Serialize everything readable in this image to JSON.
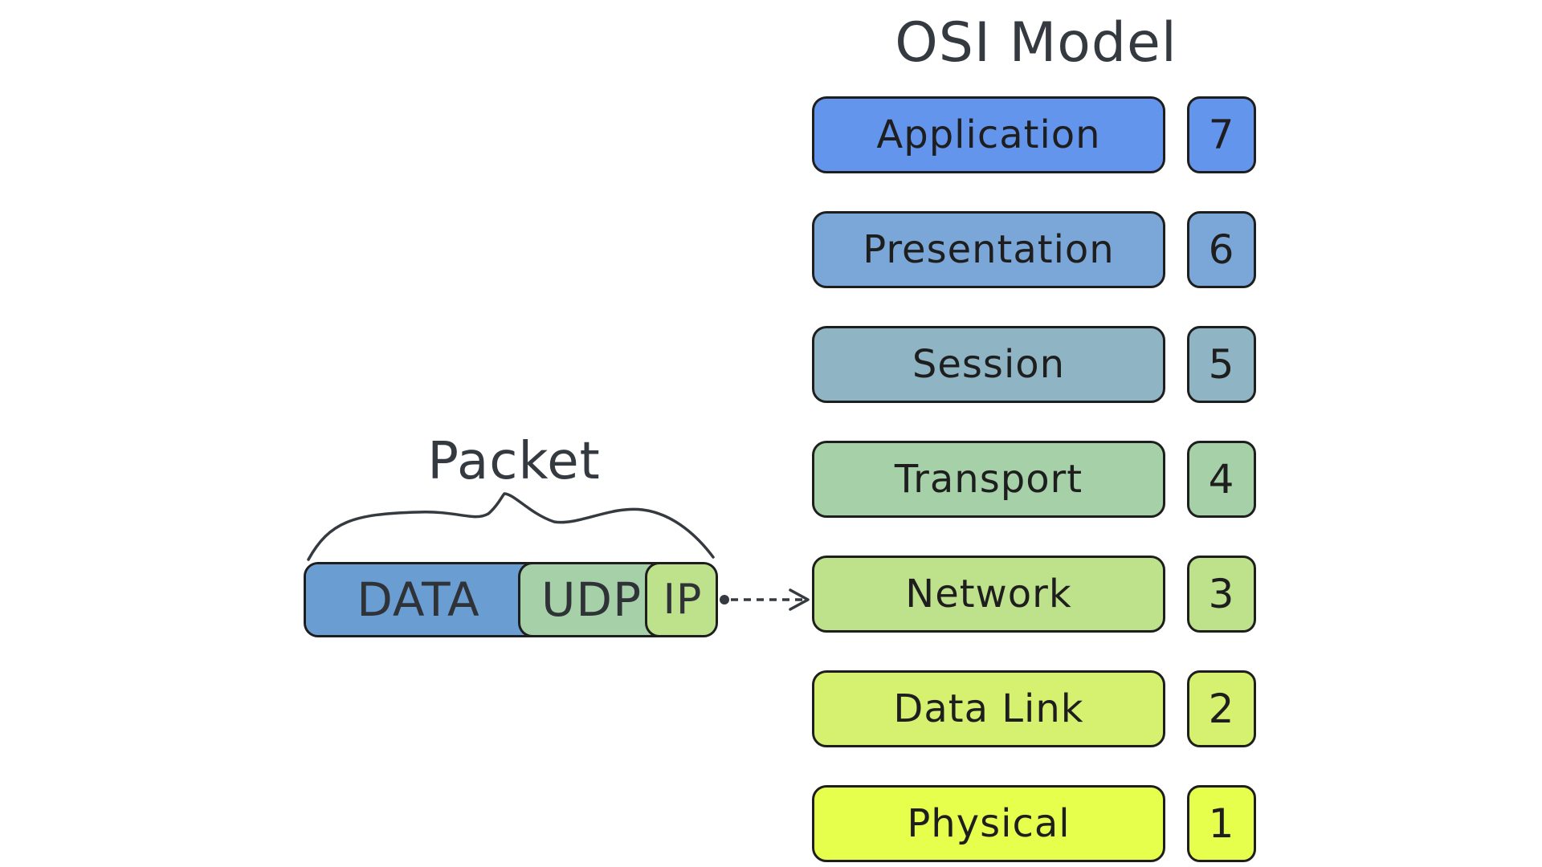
{
  "title": "OSI Model",
  "layers": [
    {
      "name": "Application",
      "number": "7",
      "color": "#6495ED"
    },
    {
      "name": "Presentation",
      "number": "6",
      "color": "#7BA7D8"
    },
    {
      "name": "Session",
      "number": "5",
      "color": "#8FB4C4"
    },
    {
      "name": "Transport",
      "number": "4",
      "color": "#A6D1A8"
    },
    {
      "name": "Network",
      "number": "3",
      "color": "#BEE18C"
    },
    {
      "name": "Data Link",
      "number": "2",
      "color": "#D6F070"
    },
    {
      "name": "Physical",
      "number": "1",
      "color": "#E6FF4D"
    }
  ],
  "packet": {
    "label": "Packet",
    "segments": [
      {
        "name": "DATA",
        "color": "#6A9ED3"
      },
      {
        "name": "UDP",
        "color": "#A6D1A8"
      },
      {
        "name": "IP",
        "color": "#BEE18C"
      }
    ],
    "points_to_layer": "Network"
  }
}
